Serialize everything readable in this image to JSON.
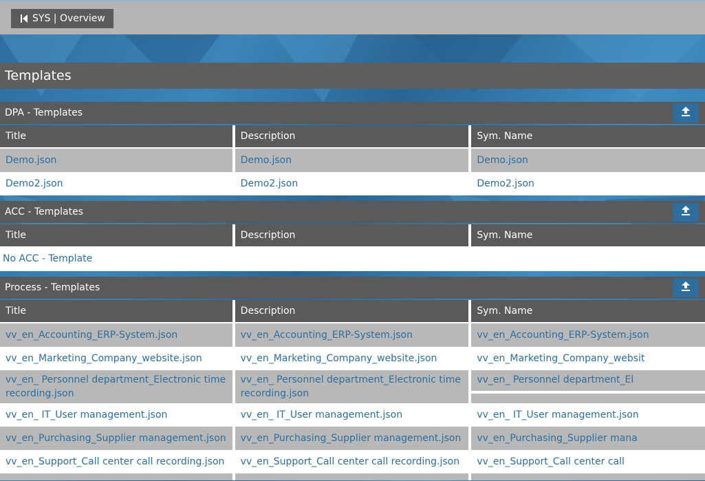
{
  "breadcrumb": {
    "label": "SYS | Overview"
  },
  "page": {
    "title": "Templates"
  },
  "columns": {
    "title": "Title",
    "description": "Description",
    "sym_name": "Sym. Name"
  },
  "sections": {
    "dpa": {
      "heading": "DPA - Templates",
      "rows": [
        {
          "title": "Demo.json",
          "description": "Demo.json",
          "sym": "Demo.json"
        },
        {
          "title": "Demo2.json",
          "description": "Demo2.json",
          "sym": "Demo2.json"
        }
      ]
    },
    "acc": {
      "heading": "ACC - Templates",
      "empty": "No ACC - Template"
    },
    "process": {
      "heading": "Process - Templates",
      "rows": [
        {
          "title": "vv_en_Accounting_ERP-System.json",
          "description": "vv_en_Accounting_ERP-System.json",
          "sym": "vv_en_Accounting_ERP-System.json"
        },
        {
          "title": "vv_en_Marketing_Company_website.json",
          "description": "vv_en_Marketing_Company_website.json",
          "sym": "vv_en_Marketing_Company_websit"
        },
        {
          "title": "vv_en_ Personnel department_Electronic time recording.json",
          "description": "vv_en_ Personnel department_Electronic time recording.json",
          "sym": "vv_en_ Personnel department_El"
        },
        {
          "title": "vv_en_ IT_User management.json",
          "description": "vv_en_ IT_User management.json",
          "sym": "vv_en_ IT_User management.json"
        },
        {
          "title": "vv_en_Purchasing_Supplier management.json",
          "description": "vv_en_Purchasing_Supplier management.json",
          "sym": "vv_en_Purchasing_Supplier mana"
        },
        {
          "title": "vv_en_Support_Call center call recording.json",
          "description": "vv_en_Support_Call center call recording.json",
          "sym": "vv_en_Support_Call center call"
        }
      ]
    }
  },
  "icons": {
    "back": "skip-back-icon",
    "upload": "upload-icon"
  },
  "colors": {
    "accent": "#2d6e9f",
    "header": "#5a5a5a",
    "row_alt": "#b8b8b8",
    "topbar": "#b5b5b5"
  }
}
